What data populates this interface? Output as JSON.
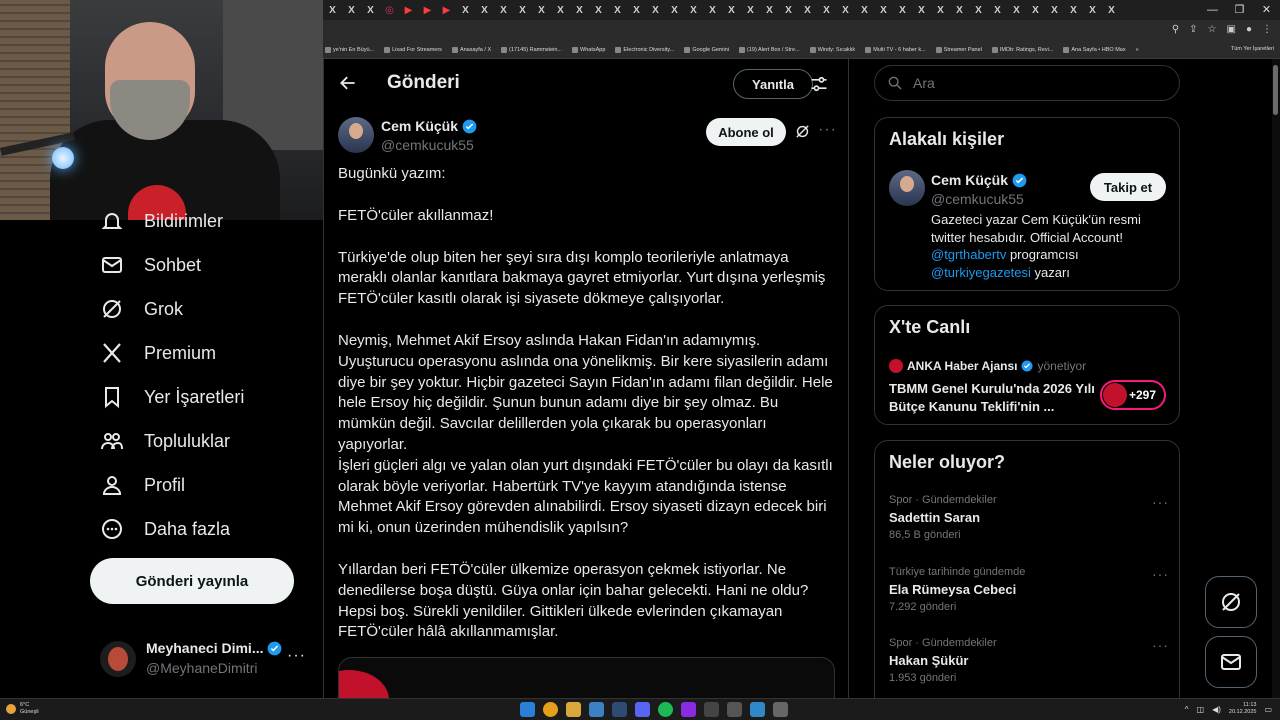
{
  "browser": {
    "tab_glyphs": [
      "X",
      "X",
      "X",
      "◎",
      "▶",
      "▶",
      "▶",
      "X",
      "X",
      "X",
      "X",
      "X",
      "X",
      "X",
      "X",
      "X",
      "X",
      "X",
      "X",
      "X",
      "X",
      "X",
      "X",
      "X",
      "X",
      "X",
      "X",
      "X",
      "X",
      "X",
      "X",
      "X",
      "X",
      "X",
      "X",
      "X",
      "X",
      "X",
      "X",
      "X",
      "X",
      "X"
    ],
    "bookmarks": [
      "ye'nin En Büyü...",
      "Lixad For Streamers",
      "Anasayfa / X",
      "(17145) Rammstein...",
      "WhatsApp",
      "Electronic Diversity...",
      "Google Gemini",
      "(19) Alert Box / Stre...",
      "Windy: Sıcaklık",
      "Multi TV - 6 haber k...",
      "Streamer Panel",
      "IMDb: Ratings, Revi...",
      "Ana Sayfa • HBO Max"
    ],
    "bookmarks_overflow": "»",
    "all_bookmarks": "Tüm Yer İşaretleri"
  },
  "nav": {
    "notifications": "Bildirimler",
    "messages": "Sohbet",
    "grok": "Grok",
    "premium": "Premium",
    "bookmarks": "Yer İşaretleri",
    "communities": "Topluluklar",
    "profile": "Profil",
    "more": "Daha fazla",
    "post_button": "Gönderi yayınla",
    "me_name": "Meyhaneci Dimi...",
    "me_handle": "@MeyhaneDimitri",
    "me_more": "···"
  },
  "header": {
    "title": "Gönderi",
    "reply_button": "Yanıtla"
  },
  "post": {
    "author_name": "Cem Küçük",
    "author_handle": "@cemkucuk55",
    "subscribe_button": "Abone ol",
    "more": "···",
    "paragraphs": [
      "Bugünkü yazım:",
      "FETÖ'cüler akıllanmaz!",
      "Türkiye'de olup biten her şeyi sıra dışı komplo teorileriyle anlatmaya meraklı olanlar kanıtlara bakmaya gayret etmiyorlar. Yurt dışına yerleşmiş FETÖ'cüler kasıtlı olarak işi siyasete dökmeye çalışıyorlar.",
      "Neymiş, Mehmet Akif Ersoy aslında Hakan Fidan'ın adamıymış. Uyuşturucu operasyonu aslında ona yönelikmiş. Bir kere siyasilerin adamı diye bir şey yoktur. Hiçbir gazeteci Sayın Fidan'ın adamı filan değildir. Hele hele Ersoy hiç değildir. Şunun bunun adamı diye bir şey olmaz. Bu mümkün değil. Savcılar delillerden yola çıkarak bu operasyonları yapıyorlar.\nİşleri güçleri algı ve yalan olan yurt dışındaki FETÖ'cüler bu olayı da kasıtlı olarak böyle veriyorlar. Habertürk TV'ye kayyım atandığında istense Mehmet Akif Ersoy görevden alınabilirdi. Ersoy siyaseti dizayn edecek biri mi ki, onun üzerinden mühendislik yapılsın?",
      "Yıllardan beri FETÖ'cüler ülkemize operasyon çekmek istiyorlar. Ne denedilerse boşa düştü. Güya onlar için bahar gelecekti. Hani ne oldu? Hepsi boş. Sürekli yenildiler. Gittikleri ülkede evlerinden çıkamayan FETÖ'cüler hâlâ akıllanmamışlar."
    ]
  },
  "right": {
    "search_placeholder": "Ara",
    "related_title": "Alakalı kişiler",
    "related_name": "Cem Küçük",
    "related_handle": "@cemkucuk55",
    "follow_button": "Takip et",
    "bio_text": "Gazeteci yazar Cem Küçük'ün resmi twitter hesabıdır. Official Account!",
    "bio_link1": "@tgrthabertv",
    "bio_mid": " programcısı ",
    "bio_link2": "@turkiyegazetesi",
    "bio_end": " yazarı",
    "live_title": "X'te Canlı",
    "live_source": "ANKA Haber Ajansı",
    "live_role": "yönetiyor",
    "live_headline": "TBMM Genel Kurulu'nda 2026 Yılı Bütçe Kanunu Teklifi'nin ...",
    "live_count": "+297",
    "trends_title": "Neler oluyor?",
    "trends": [
      {
        "context": "Spor · Gündemdekiler",
        "name": "Sadettin Saran",
        "count": "86,5 B gönderi"
      },
      {
        "context": "Türkiye tarihinde gündemde",
        "name": "Ela Rümeysa Cebeci",
        "count": "7.292 gönderi"
      },
      {
        "context": "Spor · Gündemdekiler",
        "name": "Hakan Şükür",
        "count": "1.953 gönderi"
      }
    ]
  },
  "taskbar": {
    "temp": "6°C",
    "weather": "Güneşli",
    "time": "11:13",
    "date": "20.12.2025"
  },
  "colors": {
    "accent": "#1d9bf0",
    "live_ring": "#f91880",
    "anka_red": "#c2112a"
  }
}
